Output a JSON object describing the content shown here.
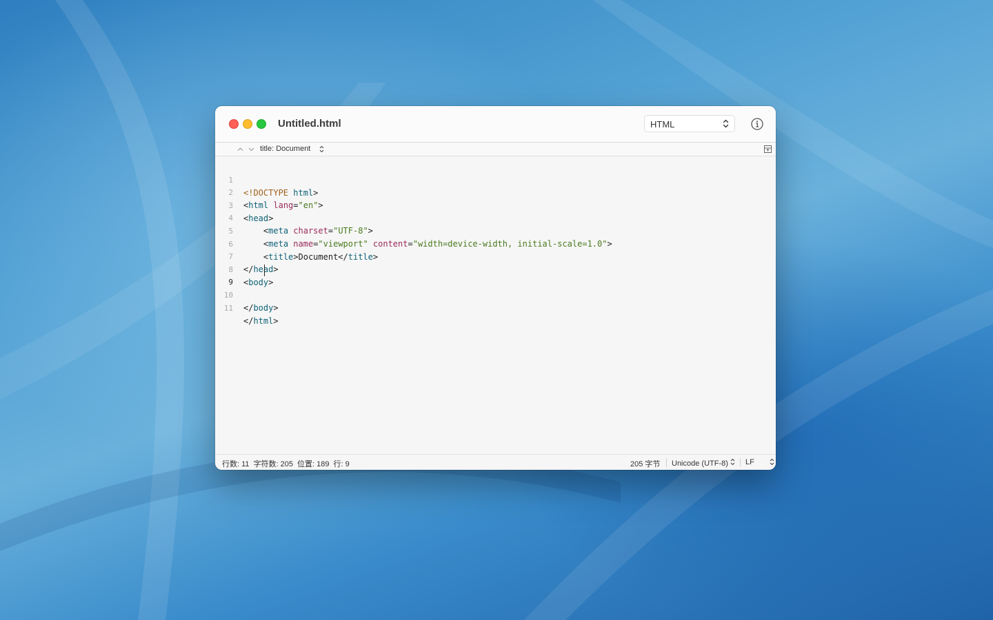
{
  "window": {
    "title": "Untitled.html",
    "syntax": "HTML"
  },
  "navigation": {
    "symbol": "title: Document"
  },
  "editor": {
    "current_line": 9,
    "lines": [
      {
        "num": "1"
      },
      {
        "num": "2"
      },
      {
        "num": "3"
      },
      {
        "num": "4"
      },
      {
        "num": "5"
      },
      {
        "num": "6"
      },
      {
        "num": "7"
      },
      {
        "num": "8"
      },
      {
        "num": "9"
      },
      {
        "num": "10"
      },
      {
        "num": "11"
      }
    ],
    "tokens": {
      "l1_doctype": "<!DOCTYPE",
      "l1_html": "html",
      "l1_close": ">",
      "l2_open": "<",
      "l2_tag": "html",
      "l2_attr": "lang",
      "l2_eq": "=",
      "l2_val": "\"en\"",
      "l2_close": ">",
      "l3_open": "<",
      "l3_tag": "head",
      "l3_close": ">",
      "l4_indent": "    ",
      "l4_open": "<",
      "l4_tag": "meta",
      "l4_attr": "charset",
      "l4_eq": "=",
      "l4_val": "\"UTF-8\"",
      "l4_close": ">",
      "l5_indent": "    ",
      "l5_open": "<",
      "l5_tag": "meta",
      "l5_attr1": "name",
      "l5_eq1": "=",
      "l5_val1": "\"viewport\"",
      "l5_attr2": "content",
      "l5_eq2": "=",
      "l5_val2": "\"width=device-width, initial-scale=1.0\"",
      "l5_close": ">",
      "l6_indent": "    ",
      "l6_open": "<",
      "l6_tag": "title",
      "l6_mid": ">Document</",
      "l6_tag2": "title",
      "l6_close": ">",
      "l7_open": "</",
      "l7_tag": "head",
      "l7_close": ">",
      "l8_open": "<",
      "l8_tag": "body",
      "l8_close": ">",
      "l10_open": "</",
      "l10_tag": "body",
      "l10_close": ">",
      "l11_open": "</",
      "l11_tag": "html",
      "l11_close": ">"
    }
  },
  "status": {
    "lines_label": "行数: 11",
    "chars_label": "字符数: 205",
    "position_label": "位置: 189",
    "row_label": "行: 9",
    "bytes": "205 字节",
    "encoding": "Unicode (UTF-8)",
    "line_ending": "LF"
  },
  "colors": {
    "tag": "#0e6276",
    "attribute": "#9b2a5a",
    "string": "#4a7a1e",
    "doctype": "#a0621d",
    "close": "#fe5f57",
    "minimize": "#febc2e",
    "maximize": "#28c840"
  },
  "icons": {
    "info": "info-circle-icon",
    "split": "split-editor-icon"
  }
}
